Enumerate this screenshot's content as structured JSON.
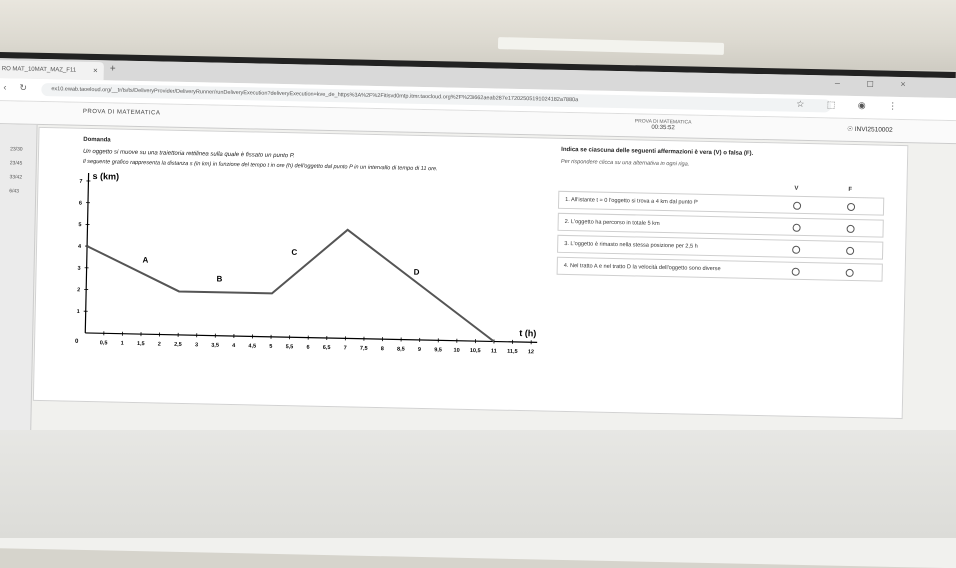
{
  "browser": {
    "tab_title": "RO MAT_10MAT_MAZ_F11",
    "tab_close": "×",
    "new_tab": "+",
    "url": "ex10.ewab.taoeloud.org/__tr/ts/ts/DeliveryProvider/DeliveryRunner/runDeliveryExecution?deliveryExecution=kve_de_https%3A%2F%2Fitisvd0mtp.itmr.taocloud.org%2F%23i662aeab287e17202505191024182a7880a",
    "back": "‹",
    "reload": "↻",
    "window_controls": "– ◻ ×",
    "icons": "☆ ⬚ ◉ ⋮"
  },
  "exam": {
    "app_title": "PROVA DI MATEMATICA",
    "center_title": "PROVA DI MATEMATICA",
    "timer": "00:35:52",
    "user": "INVI2510002"
  },
  "sidebar": {
    "items": [
      "23/30",
      "23/45",
      "33/42",
      "6/43"
    ]
  },
  "question": {
    "title": "Domanda",
    "text1": "Un oggetto si muove su una traiettoria rettilinea sulla quale è fissato un punto P.",
    "text2": "Il seguente grafico rappresenta la distanza s (in km) in funzione del tempo t in ore (h) dell'oggetto dal punto P in un intervallo di tempo di 11 ore.",
    "instruction_title": "Indica se ciascuna delle seguenti affermazioni è vera (V) o falsa (F).",
    "instruction_sub": "Per rispondere clicca su una alternativa in ogni riga.",
    "col_v": "V",
    "col_f": "F",
    "statements": [
      "1. All'istante t = 0 l'oggetto si trova a 4 km dal punto P",
      "2. L'oggetto ha percorso in totale 5 km",
      "3. L'oggetto è rimasto nella stessa posizione per 2,5 h",
      "4. Nel tratto A e nel tratto D la velocità dell'oggetto sono diverse"
    ]
  },
  "chart_data": {
    "type": "line",
    "ylabel": "s (km)",
    "xlabel": "t (h)",
    "x_ticks": [
      "0,5",
      "1",
      "1,5",
      "2",
      "2,5",
      "3",
      "3,5",
      "4",
      "4,5",
      "5",
      "5,5",
      "6",
      "6,5",
      "7",
      "7,5",
      "8",
      "8,5",
      "9",
      "9,5",
      "10",
      "10,5",
      "11",
      "11,5",
      "12"
    ],
    "y_ticks": [
      "0",
      "1",
      "2",
      "3",
      "4",
      "5",
      "6",
      "7"
    ],
    "origin_label": "0",
    "xlim": [
      0,
      12
    ],
    "ylim": [
      0,
      7
    ],
    "series": [
      {
        "x": [
          0,
          2.5,
          5,
          7,
          11
        ],
        "y": [
          4,
          2,
          2,
          5,
          0
        ]
      }
    ],
    "segment_labels": [
      {
        "text": "A",
        "x": 1.5,
        "y": 3.3
      },
      {
        "text": "B",
        "x": 3.5,
        "y": 2.5
      },
      {
        "text": "C",
        "x": 5.5,
        "y": 3.8
      },
      {
        "text": "D",
        "x": 8.8,
        "y": 3.0
      }
    ]
  }
}
